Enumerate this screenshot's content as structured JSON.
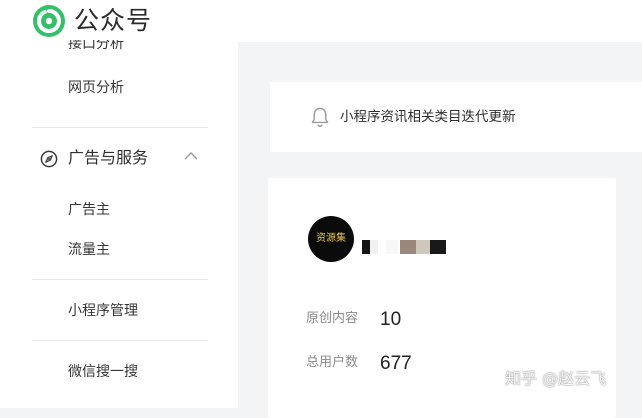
{
  "header": {
    "app_name": "公众号",
    "logo_icon": "wechat-official-account-logo-icon",
    "brand_color": "#33c069"
  },
  "sidebar": {
    "clipped_item": "接口分析",
    "items_top": [
      "网页分析"
    ],
    "section": {
      "label": "广告与服务",
      "icon": "compass-icon",
      "expanded_icon": "chevron-up-icon"
    },
    "section_items": [
      "广告主",
      "流量主"
    ],
    "items_bottom": [
      "小程序管理",
      "微信搜一搜"
    ]
  },
  "notice": {
    "icon": "bell-icon",
    "text": "小程序资讯相关类目迭代更新"
  },
  "account_card": {
    "avatar_text": "资源集",
    "stats": [
      {
        "label": "原创内容",
        "value": "10"
      },
      {
        "label": "总用户数",
        "value": "677"
      }
    ]
  },
  "watermark": {
    "text": "知乎 @赵云飞"
  }
}
